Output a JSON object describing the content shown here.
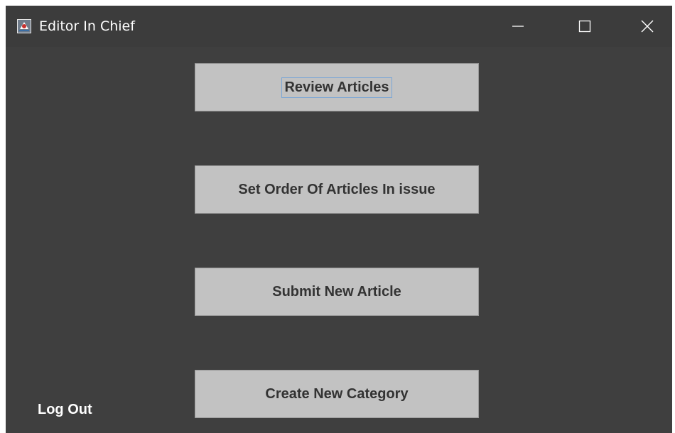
{
  "window": {
    "title": "Editor In Chief",
    "app_icon": "java-app-icon",
    "controls": {
      "minimize_icon": "minimize-icon",
      "maximize_icon": "maximize-icon",
      "close_icon": "close-icon"
    }
  },
  "menu": {
    "buttons": [
      {
        "label": "Review Articles"
      },
      {
        "label": "Set Order Of Articles In issue"
      },
      {
        "label": "Submit New Article"
      },
      {
        "label": "Create New Category"
      }
    ]
  },
  "logout": {
    "label": "Log Out"
  },
  "colors": {
    "titlebar": "#3c3c3c",
    "background": "#3f3f3f",
    "button": "#c2c2c2",
    "button_text": "#333333",
    "link_text": "#ffffff",
    "focus_ring": "#7aa6d6"
  }
}
